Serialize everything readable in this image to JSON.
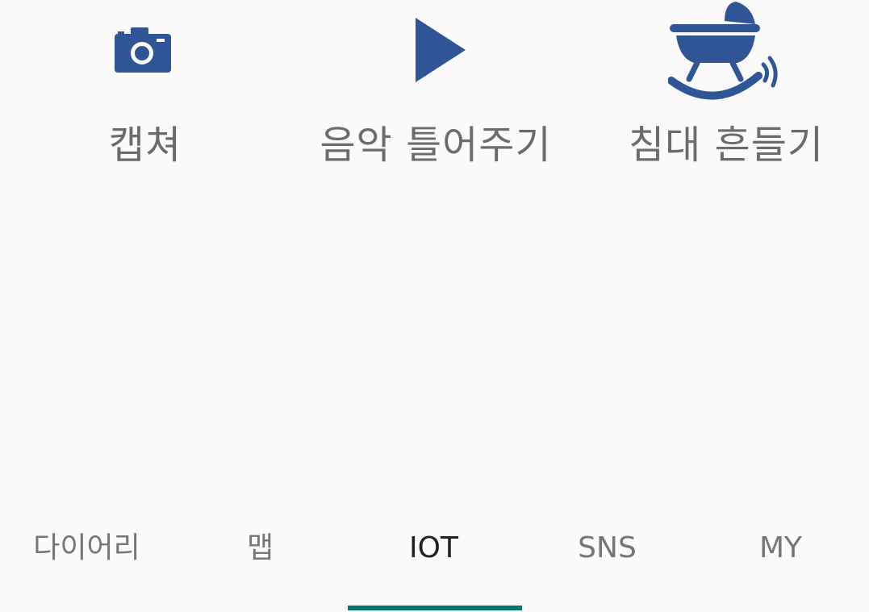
{
  "colors": {
    "accent": "#00796b",
    "icon": "#2f5597",
    "label": "#6b6b6b",
    "tab_inactive": "#757575",
    "tab_active": "#212121",
    "background": "#fafafa"
  },
  "actions": [
    {
      "label": "캡쳐",
      "icon": "camera-icon"
    },
    {
      "label": "음악 틀어주기",
      "icon": "play-icon"
    },
    {
      "label": "침대 흔들기",
      "icon": "rocking-cradle-icon"
    }
  ],
  "tabs": {
    "items": [
      {
        "label": "다이어리"
      },
      {
        "label": "맵"
      },
      {
        "label": "IOT"
      },
      {
        "label": "SNS"
      },
      {
        "label": "MY"
      }
    ],
    "selected": "IOT"
  }
}
